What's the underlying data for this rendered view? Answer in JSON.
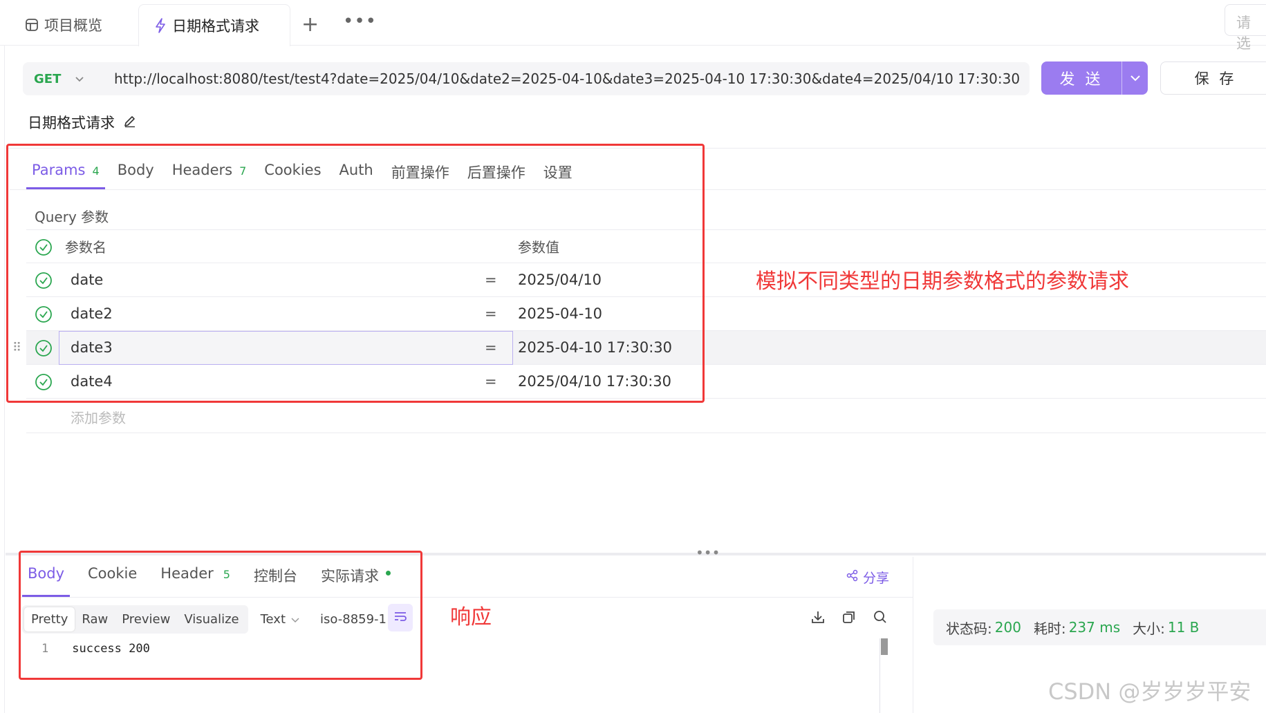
{
  "tabs": [
    {
      "label": "项目概览",
      "icon": "overview-icon"
    },
    {
      "label": "日期格式请求",
      "icon": "lightning-icon"
    }
  ],
  "filter_placeholder": "请选",
  "request": {
    "method": "GET",
    "url": "http://localhost:8080/test/test4?date=2025/04/10&date2=2025-04-10&date3=2025-04-10 17:30:30&date4=2025/04/10 17:30:30",
    "send_label": "发 送",
    "save_label": "保 存",
    "name": "日期格式请求"
  },
  "request_tabs": [
    {
      "label": "Params",
      "count": "4"
    },
    {
      "label": "Body",
      "count": ""
    },
    {
      "label": "Headers",
      "count": "7"
    },
    {
      "label": "Cookies",
      "count": ""
    },
    {
      "label": "Auth",
      "count": ""
    },
    {
      "label": "前置操作",
      "count": ""
    },
    {
      "label": "后置操作",
      "count": ""
    },
    {
      "label": "设置",
      "count": ""
    }
  ],
  "query": {
    "label": "Query 参数",
    "header_name": "参数名",
    "header_value": "参数值",
    "rows": [
      {
        "name": "date",
        "eq": "=",
        "value": "2025/04/10"
      },
      {
        "name": "date2",
        "eq": "=",
        "value": "2025-04-10"
      },
      {
        "name": "date3",
        "eq": "=",
        "value": "2025-04-10 17:30:30"
      },
      {
        "name": "date4",
        "eq": "=",
        "value": "2025/04/10 17:30:30"
      }
    ],
    "add_placeholder": "添加参数"
  },
  "annotations": {
    "request_note": "模拟不同类型的日期参数格式的参数请求",
    "response_note": "响应"
  },
  "response_tabs": [
    {
      "label": "Body",
      "count": ""
    },
    {
      "label": "Cookie",
      "count": ""
    },
    {
      "label": "Header",
      "count": "5"
    },
    {
      "label": "控制台",
      "count": ""
    },
    {
      "label": "实际请求",
      "count": ""
    }
  ],
  "share_label": "分享",
  "format": {
    "modes": [
      "Pretty",
      "Raw",
      "Preview",
      "Visualize"
    ],
    "type": "Text",
    "encoding": "iso-8859-1"
  },
  "code": {
    "line": "1",
    "text": "success 200"
  },
  "status": {
    "code_label": "状态码:",
    "code": "200",
    "time_label": "耗时:",
    "time": "237 ms",
    "size_label": "大小:",
    "size": "11 B"
  },
  "watermark": "CSDN @岁岁岁平安",
  "colors": {
    "accent": "#7c5ce6",
    "success": "#2aa64f",
    "annotation": "#f03838"
  }
}
